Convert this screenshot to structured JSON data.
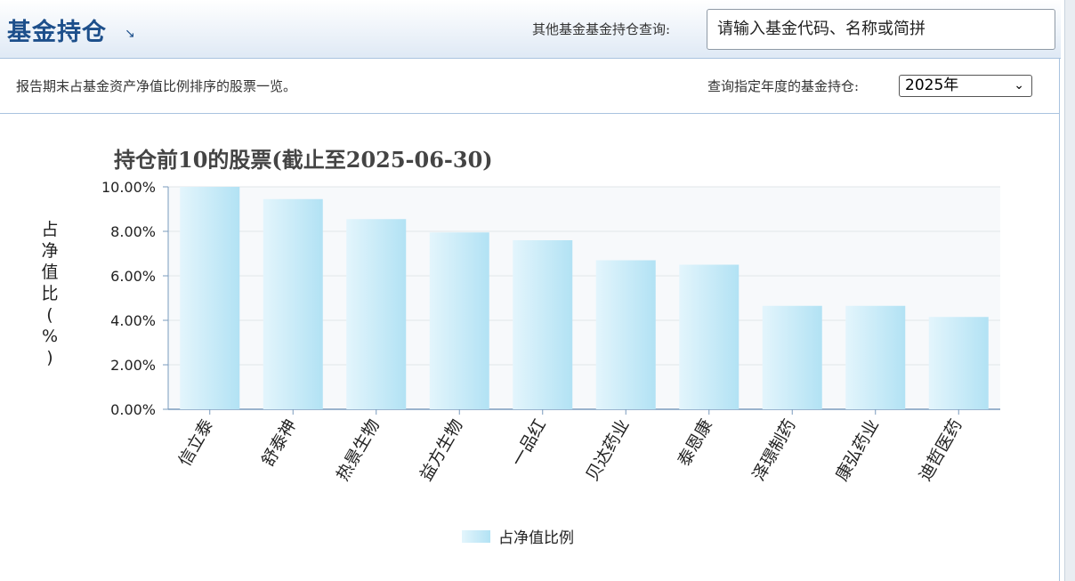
{
  "header": {
    "title": "基金持仓",
    "title_icon": "arrow-down-right-icon",
    "other_fund_label": "其他基金基金持仓查询:",
    "search_placeholder": "请输入基金代码、名称或简拼"
  },
  "panel": {
    "description": "报告期末占基金资产净值比例排序的股票一览。",
    "year_label": "查询指定年度的基金持仓:",
    "year_selected": "2025年"
  },
  "chart_data": {
    "type": "bar",
    "title": "持仓前10的股票(截止至2025-06-30)",
    "ylabel": "占净值比(%)",
    "ylabel_chars": [
      "占",
      "净",
      "值",
      "比",
      "(",
      "%",
      ")"
    ],
    "y_ticks": [
      "0.00%",
      "2.00%",
      "4.00%",
      "6.00%",
      "8.00%",
      "10.00%"
    ],
    "ylim": [
      0,
      10
    ],
    "categories": [
      "信立泰",
      "舒泰神",
      "热景生物",
      "益方生物",
      "一品红",
      "贝达药业",
      "泰恩康",
      "泽璟制药",
      "康弘药业",
      "迪哲医药"
    ],
    "series": [
      {
        "name": "占净值比例",
        "values": [
          10.0,
          9.45,
          8.55,
          7.95,
          7.6,
          6.7,
          6.5,
          4.65,
          4.65,
          4.15
        ]
      }
    ],
    "bar_color": "#bde6f6",
    "grid": true,
    "legend_position": "bottom"
  }
}
